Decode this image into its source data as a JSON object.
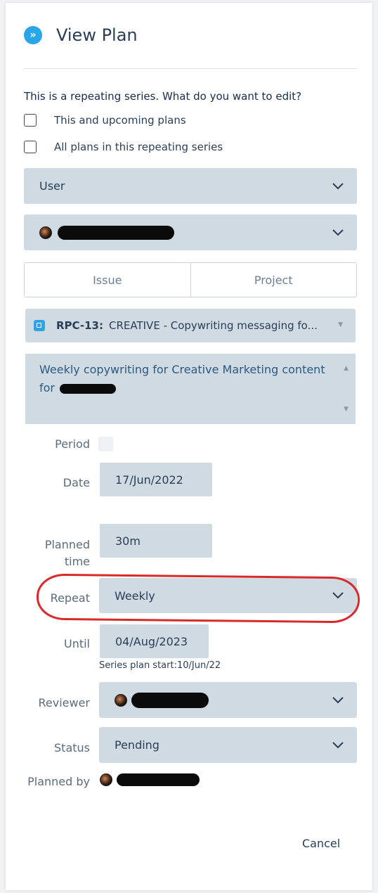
{
  "header": {
    "title": "View Plan",
    "expand_icon": "double-chevron-right-icon",
    "accent": "#2aa6e8"
  },
  "scope": {
    "question": "This is a repeating series. What do you want to edit?",
    "options": [
      "This and upcoming plans",
      "All plans in this repeating series"
    ]
  },
  "assignee_type": {
    "value": "User"
  },
  "assignee": {
    "value": ""
  },
  "tabs": [
    "Issue",
    "Project"
  ],
  "issue": {
    "key": "RPC-13:",
    "summary": "CREATIVE - Copywriting messaging fo..."
  },
  "description": {
    "text": "Weekly copywriting for Creative Marketing content for"
  },
  "form": {
    "period": {
      "label": "Period"
    },
    "date": {
      "label": "Date",
      "value": "17/Jun/2022"
    },
    "planned_time": {
      "label": "Planned time",
      "value": "30m"
    },
    "repeat": {
      "label": "Repeat",
      "value": "Weekly"
    },
    "until": {
      "label": "Until",
      "value": "04/Aug/2023",
      "hint": "Series plan start:10/Jun/22"
    },
    "reviewer": {
      "label": "Reviewer"
    },
    "status": {
      "label": "Status",
      "value": "Pending"
    },
    "planned_by": {
      "label": "Planned by"
    }
  },
  "footer": {
    "cancel_label": "Cancel"
  },
  "colors": {
    "field_bg": "#cfdae3",
    "annotation": "#d92a2a"
  }
}
